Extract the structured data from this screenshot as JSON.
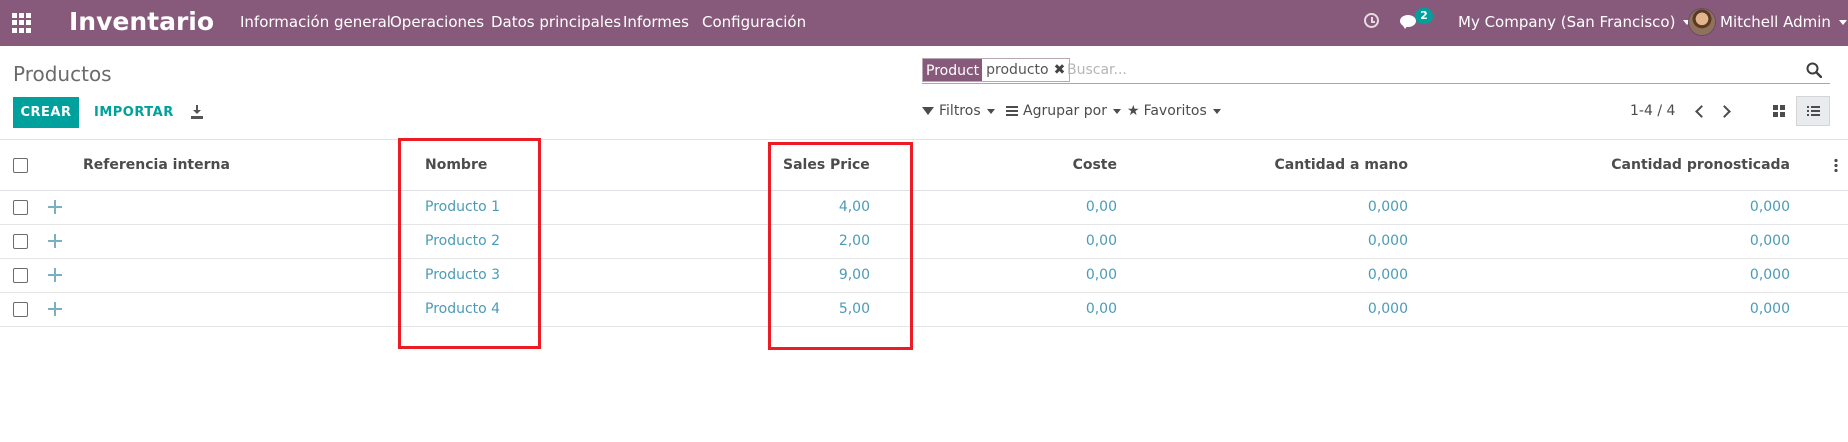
{
  "navbar": {
    "brand": "Inventario",
    "menu": [
      "Información general",
      "Operaciones",
      "Datos principales",
      "Informes",
      "Configuración"
    ],
    "chat_count": "2",
    "company": "My Company (San Francisco)",
    "user": "Mitchell Admin",
    "color": "#875a7b"
  },
  "control_panel": {
    "breadcrumb": "Productos",
    "search": {
      "facet_label": "Product",
      "facet_value": "producto",
      "facet_close": "✖",
      "placeholder": "Buscar..."
    },
    "buttons": {
      "create": "CREAR",
      "import": "IMPORTAR"
    },
    "filters": {
      "filters_label": "Filtros",
      "group_by_label": "Agrupar por",
      "favorites_label": "Favoritos"
    },
    "pager": "1-4 / 4",
    "accent_color": "#00a09d"
  },
  "table": {
    "columns": [
      "Referencia interna",
      "Nombre",
      "Sales Price",
      "Coste",
      "Cantidad a mano",
      "Cantidad pronosticada"
    ],
    "rows": [
      {
        "reference": "",
        "name": "Producto 1",
        "sales_price": "4,00",
        "cost": "0,00",
        "on_hand": "0,000",
        "forecasted": "0,000"
      },
      {
        "reference": "",
        "name": "Producto 2",
        "sales_price": "2,00",
        "cost": "0,00",
        "on_hand": "0,000",
        "forecasted": "0,000"
      },
      {
        "reference": "",
        "name": "Producto 3",
        "sales_price": "9,00",
        "cost": "0,00",
        "on_hand": "0,000",
        "forecasted": "0,000"
      },
      {
        "reference": "",
        "name": "Producto 4",
        "sales_price": "5,00",
        "cost": "0,00",
        "on_hand": "0,000",
        "forecasted": "0,000"
      }
    ]
  },
  "annotation_color": "#ec1c24"
}
